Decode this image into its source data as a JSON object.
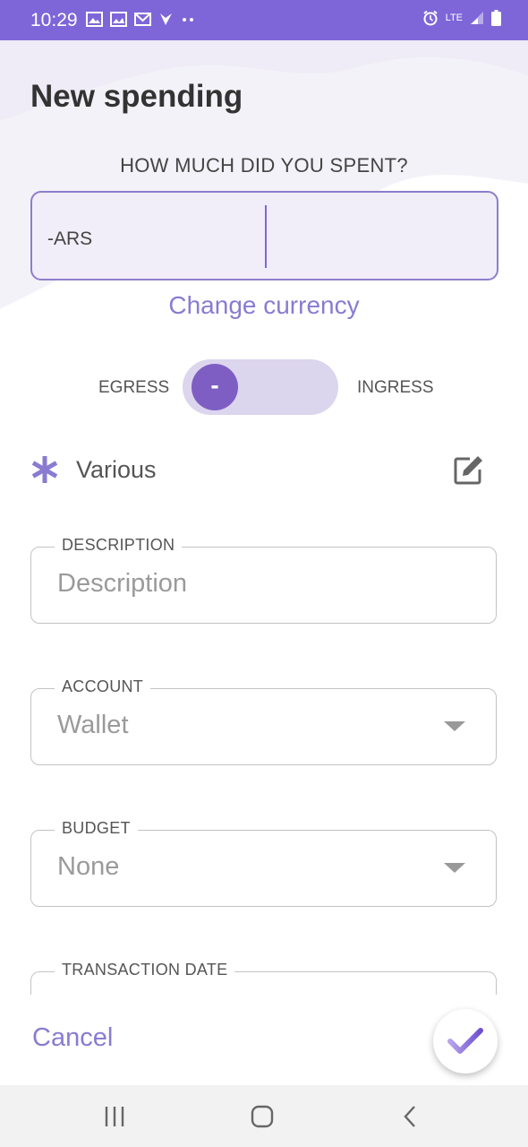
{
  "status_bar": {
    "time": "10:29",
    "network": "LTE",
    "left_icons": [
      "image-icon",
      "photo-icon",
      "gmail-icon",
      "check-icon",
      "more-dots-icon"
    ],
    "right_icons": [
      "alarm-icon",
      "lte-icon",
      "signal-icon",
      "battery-icon"
    ],
    "color": "#7e66d8"
  },
  "page": {
    "title": "New spending",
    "prompt": "HOW MUCH DID YOU SPENT?"
  },
  "amount": {
    "prefix": "-ARS",
    "value": ""
  },
  "change_currency_label": "Change currency",
  "toggle": {
    "left_label": "EGRESS",
    "right_label": "INGRESS",
    "knob_symbol": "-",
    "selected": "EGRESS"
  },
  "category": {
    "icon": "asterisk-icon",
    "label": "Various",
    "edit_icon": "edit-icon"
  },
  "fields": {
    "description": {
      "legend": "DESCRIPTION",
      "placeholder": "Description"
    },
    "account": {
      "legend": "ACCOUNT",
      "value": "Wallet"
    },
    "budget": {
      "legend": "BUDGET",
      "value": "None"
    },
    "transaction_date": {
      "legend": "TRANSACTION DATE"
    }
  },
  "actions": {
    "cancel_label": "Cancel",
    "confirm_icon": "check-icon"
  },
  "nav": {
    "items": [
      "recents-icon",
      "home-icon",
      "back-icon"
    ]
  },
  "colors": {
    "accent": "#7e66d8",
    "link": "#8a7bd1",
    "knob": "#7e5ec3",
    "track": "#dcd5ee"
  }
}
